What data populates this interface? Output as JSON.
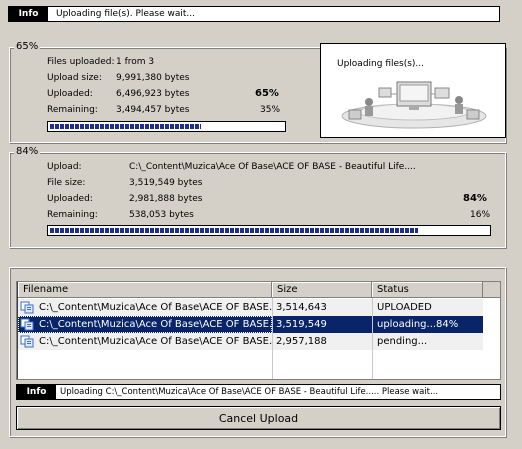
{
  "top_info": {
    "tag": "Info",
    "message": "Uploading file(s). Please wait..."
  },
  "overall": {
    "percent_title": "65%",
    "files_uploaded_label": "Files uploaded:",
    "files_uploaded_value": "1 from 3",
    "upload_size_label": "Upload size:",
    "upload_size_value": "9,991,380 bytes",
    "uploaded_label": "Uploaded:",
    "uploaded_value": "6,496,923 bytes",
    "uploaded_percent": "65%",
    "remaining_label": "Remaining:",
    "remaining_value": "3,494,457 bytes",
    "remaining_percent": "35%",
    "progress": 0.65
  },
  "image_panel": {
    "caption": "Uploading files(s)..."
  },
  "current_file": {
    "percent_title": "84%",
    "upload_label": "Upload:",
    "upload_value": "C:\\_Content\\Muzica\\Ace Of Base\\ACE OF BASE - Beautiful Life....",
    "file_size_label": "File size:",
    "file_size_value": "3,519,549 bytes",
    "uploaded_label": "Uploaded:",
    "uploaded_value": "2,981,888 bytes",
    "uploaded_percent": "84%",
    "remaining_label": "Remaining:",
    "remaining_value": "538,053 bytes",
    "remaining_percent": "16%",
    "progress": 0.84
  },
  "files_table": {
    "columns": [
      "Filename",
      "Size",
      "Status"
    ],
    "rows": [
      {
        "filename": "C:\\_Content\\Muzica\\Ace Of Base\\ACE OF BASE...",
        "size": "3,514,643",
        "status": "UPLOADED"
      },
      {
        "filename": "C:\\_Content\\Muzica\\Ace Of Base\\ACE OF BASE...",
        "size": "3,519,549",
        "status": "uploading...84%"
      },
      {
        "filename": "C:\\_Content\\Muzica\\Ace Of Base\\ACE OF BASE...",
        "size": "2,957,188",
        "status": "pending..."
      }
    ],
    "selected_row": 1
  },
  "bottom_info": {
    "tag": "Info",
    "message": "Uploading C:\\_Content\\Muzica\\Ace Of Base\\ACE OF BASE - Beautiful Life..... Please wait..."
  },
  "cancel_button": {
    "label": "Cancel Upload"
  },
  "icons": {
    "file": "copy-files-icon",
    "illustration": "network-computers-illustration"
  },
  "colors": {
    "background": "#d4d0c8",
    "progress_fill": "#1f2f8f",
    "selection": "#0a246a"
  }
}
